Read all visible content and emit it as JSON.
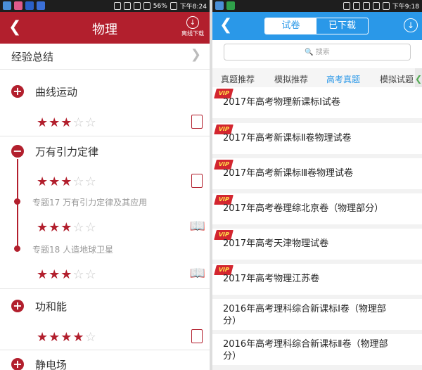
{
  "left": {
    "status_time": "下午8:24",
    "status_battery": "56%",
    "header": {
      "back_icon": "back-chevron-icon",
      "title": "物理",
      "download_label": "离线下载"
    },
    "summary": {
      "label": "经验总结"
    },
    "chapters": [
      {
        "icon": "plus",
        "title": "曲线运动",
        "rating": 3
      },
      {
        "icon": "minus",
        "title": "万有引力定律",
        "rating": 3,
        "topics": [
          {
            "label": "专题17  万有引力定律及其应用",
            "rating": 3
          },
          {
            "label": "专题18  人造地球卫星",
            "rating": 3
          }
        ]
      },
      {
        "icon": "plus",
        "title": "功和能",
        "rating": 4
      },
      {
        "icon": "plus",
        "title": "静电场"
      }
    ]
  },
  "right": {
    "status_time": "下午9:18",
    "header": {
      "seg_active": "试卷",
      "seg_inactive": "已下载"
    },
    "search": {
      "placeholder": "搜索"
    },
    "tabs": [
      "真题推荐",
      "模拟推荐",
      "高考真题",
      "模拟试题"
    ],
    "active_tab": "高考真题",
    "vip_label": "VIP",
    "papers": [
      {
        "title": "2017年高考物理新课标Ⅰ试卷",
        "vip": true
      },
      {
        "title": "2017年高考新课标Ⅱ卷物理试卷",
        "vip": true
      },
      {
        "title": "2017年高考新课标Ⅲ卷物理试卷",
        "vip": true
      },
      {
        "title": "2017年高考卷理综北京卷（物理部分）",
        "vip": true
      },
      {
        "title": "2017年高考天津物理试卷",
        "vip": true
      },
      {
        "title": "2017年高考物理江苏卷",
        "vip": true
      },
      {
        "title": "2016年高考理科综合新课标Ⅰ卷（物理部分）",
        "vip": false
      },
      {
        "title": "2016年高考理科综合新课标Ⅱ卷（物理部分）",
        "vip": false
      }
    ]
  },
  "colors": {
    "left_accent": "#b21f2d",
    "right_accent": "#2a98e8",
    "vip": "#d3262f"
  }
}
